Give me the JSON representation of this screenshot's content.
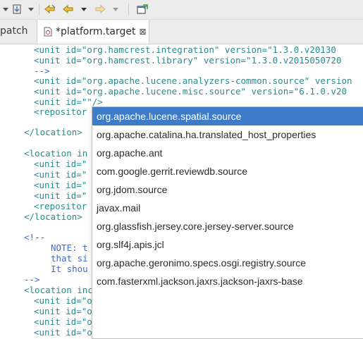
{
  "tabs": {
    "partial_label": "patch",
    "active_label": "*platform.target",
    "close_glyph": "⊠"
  },
  "editor_lines": [
    "<unit id=\"org.hamcrest.integration\" version=\"1.3.0.v20130",
    "<unit id=\"org.hamcrest.library\" version=\"1.3.0.v2015050720",
    "-->",
    "<unit id=\"org.apache.lucene.analyzers-common.source\" version",
    "<unit id=\"org.apache.lucene.misc.source\" version=\"6.1.0.v20",
    "<unit id=\"\"/>",
    "<repositor",
    "",
    "</location>",
    "",
    "<location in",
    "<unit id=\"",
    "<unit id=\"",
    "<unit id=\"",
    "<unit id=\"",
    "<repositor",
    "</location>",
    "",
    "<!--",
    "NOTE: t",
    "that si",
    "It shou",
    "-->",
    "<location includeAllPlatforms=\"true\" includeMode=\"slicer\" typ",
    "<unit id=\"org.eclipse.jetty.continuation\" version=\"9.3.14.v",
    "<unit id=\"org.eclipse.jetty.continuation.source\" version=\"9",
    "<unit id=\"org.eclipse.jetty.http\" version=\"9.3.14.v20161028",
    "<unit id=\"org.eclipse.jetty.http.source\" version=\"9.3.14.v2"
  ],
  "autocomplete": {
    "selected_index": 0,
    "items": [
      "org.apache.lucene.spatial.source",
      "org.apache.catalina.ha.translated_host_properties",
      "org.apache.ant",
      "com.google.gerrit.reviewdb.source",
      "org.jdom.source",
      "javax.mail",
      "org.glassfish.jersey.core.jersey-server.source",
      "org.slf4j.apis.jcl",
      "org.apache.geronimo.specs.osgi.registry.source",
      "com.fasterxml.jackson.jaxrs.jackson-jaxrs-base"
    ]
  },
  "colors": {
    "selection": "#3d7cc9",
    "tag": "#2a8a8a",
    "attribute": "#8a2a8a",
    "value": "#2a2ae0",
    "comment": "#3a6ad0"
  },
  "toolbar_icons": [
    "history-dropdown-icon",
    "back-to-edit-location-icon",
    "back-icon",
    "back-dropdown-icon",
    "forward-icon",
    "forward-dropdown-icon",
    "external-window-icon"
  ]
}
